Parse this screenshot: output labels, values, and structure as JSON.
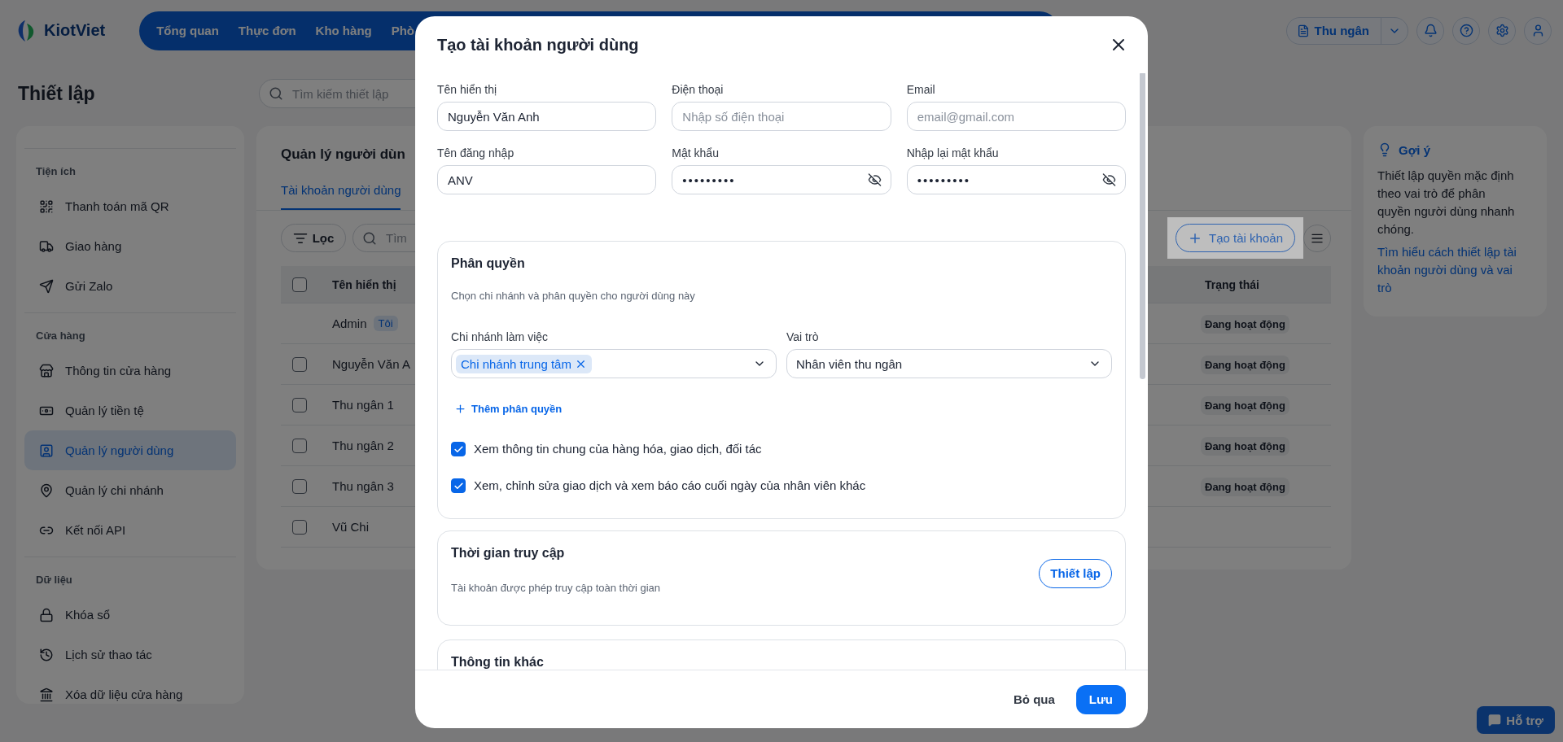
{
  "app": {
    "logo": "KiotViet",
    "nav": [
      "Tổng quan",
      "Thực đơn",
      "Kho hàng",
      "Phò"
    ],
    "role_button": "Thu ngân"
  },
  "page": {
    "title": "Thiết lập",
    "search_placeholder": "Tìm kiếm thiết lập"
  },
  "sidebar": {
    "sections": [
      {
        "title": "Tiện ích",
        "items": [
          {
            "label": "Thanh toán mã QR",
            "selected": false
          },
          {
            "label": "Giao hàng",
            "selected": false
          },
          {
            "label": "Gửi Zalo",
            "selected": false
          }
        ]
      },
      {
        "title": "Cửa hàng",
        "items": [
          {
            "label": "Thông tin cửa hàng",
            "selected": false
          },
          {
            "label": "Quản lý tiền tệ",
            "selected": false
          },
          {
            "label": "Quản lý người dùng",
            "selected": true
          },
          {
            "label": "Quản lý chi nhánh",
            "selected": false
          },
          {
            "label": "Kết nối API",
            "selected": false
          }
        ]
      },
      {
        "title": "Dữ liệu",
        "items": [
          {
            "label": "Khóa sổ",
            "selected": false
          },
          {
            "label": "Lịch sử thao tác",
            "selected": false
          },
          {
            "label": "Xóa dữ liệu cửa hàng",
            "selected": false
          }
        ]
      }
    ]
  },
  "panel": {
    "title": "Quản lý người dùn",
    "tabs": [
      {
        "label": "Tài khoản người dùng",
        "selected": true
      }
    ],
    "filter_button": "Lọc",
    "search_placeholder": "Tìm",
    "create_button": "Tạo tài khoản",
    "columns": [
      "Tên hiển thị",
      "Trạng thái"
    ],
    "all_checked": false,
    "rows": [
      {
        "kind": "current",
        "name": "Admin",
        "badge": "Tôi",
        "status": "Đang hoạt động"
      },
      {
        "kind": "user",
        "name": "Nguyễn Văn A",
        "checked": false,
        "status": "Đang hoạt động"
      },
      {
        "kind": "user",
        "name": "Thu ngân 1",
        "checked": false,
        "status": "Đang hoạt động"
      },
      {
        "kind": "user",
        "name": "Thu ngân 2",
        "checked": false,
        "status": "Đang hoạt động"
      },
      {
        "kind": "user",
        "name": "Thu ngân 3",
        "checked": false,
        "status": "Đang hoạt động"
      },
      {
        "kind": "user",
        "name": "Vũ Chi",
        "checked": false
      }
    ]
  },
  "hint": {
    "title": "Gợi ý",
    "text": "Thiết lập quyền mặc định theo vai trò để phân quyền người dùng nhanh chóng.",
    "link": "Tìm hiểu cách thiết lập tài khoản người dùng và vai trò"
  },
  "dialog": {
    "title": "Tạo tài khoản người dùng",
    "fields": [
      {
        "kind": "text",
        "label": "Tên hiển thị",
        "value": "Nguyễn Văn Anh"
      },
      {
        "kind": "text",
        "label": "Điện thoại",
        "placeholder": "Nhập số điện thoại"
      },
      {
        "kind": "text",
        "label": "Email",
        "placeholder": "email@gmail.com"
      },
      {
        "kind": "text",
        "label": "Tên đăng nhập",
        "value": "ANV"
      },
      {
        "kind": "password",
        "label": "Mật khẩu",
        "value": "•••••••••"
      },
      {
        "kind": "password",
        "label": "Nhập lại mật khẩu",
        "value": "•••••••••"
      }
    ],
    "permission": {
      "title": "Phân quyền",
      "subtitle": "Chọn chi nhánh và phân quyền cho người dùng này",
      "branch_label": "Chi nhánh làm việc",
      "branches": [
        "Chi nhánh trung tâm"
      ],
      "role_label": "Vai trò",
      "role": "Nhân viên thu ngân",
      "add_button": "Thêm phân quyền",
      "options": [
        {
          "label": "Xem thông tin chung của hàng hóa, giao dịch, đối tác",
          "checked": true
        },
        {
          "label": "Xem, chỉnh sửa giao dịch và xem báo cáo cuối ngày của nhân viên khác",
          "checked": true
        }
      ]
    },
    "access": {
      "title": "Thời gian truy cập",
      "text": "Tài khoản được phép truy cập toàn thời gian",
      "button": "Thiết lập"
    },
    "other": {
      "title": "Thông tin khác"
    },
    "cancel_button": "Bỏ qua",
    "save_button": "Lưu"
  },
  "help_button": "Hỗ trợ"
}
